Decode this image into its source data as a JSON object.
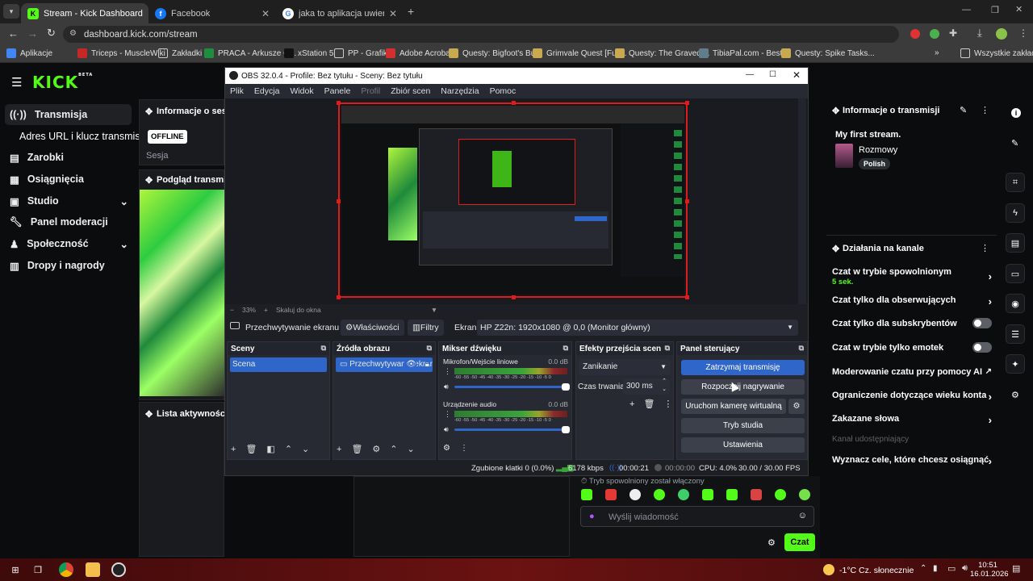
{
  "browser": {
    "tabs": [
      {
        "title": "Stream - Kick Dashboard",
        "active": true
      },
      {
        "title": "Facebook",
        "active": false
      },
      {
        "title": "jaka to aplikacja uwierzytelniająca",
        "active": false
      }
    ],
    "url": "dashboard.kick.com/stream",
    "bookmarks": [
      "Aplikacje",
      "Triceps - MuscleWiki",
      "Zakładki",
      "PRACA - Arkusze G...",
      "xStation 5",
      "PP - Grafik",
      "Adobe Acrobat",
      "Questy: Bigfoot's Bu...",
      "Grimvale Quest [Full...",
      "Questy: The Gravedi...",
      "TibiaPal.com - Besti...",
      "Questy: Spike Tasks..."
    ],
    "all_bookmarks": "Wszystkie zakładki"
  },
  "kick": {
    "logo": "KICK",
    "logo_badge": "BETA",
    "nav": [
      {
        "label": "Transmisja",
        "icon": "broadcast-icon"
      },
      {
        "label": "Adres URL i klucz transmisji",
        "icon": ""
      },
      {
        "label": "Zarobki",
        "icon": "wallet-icon"
      },
      {
        "label": "Osiągnięcia",
        "icon": "achievement-icon"
      },
      {
        "label": "Studio",
        "icon": "studio-icon"
      },
      {
        "label": "Panel moderacji",
        "icon": "wrench-icon"
      },
      {
        "label": "Społeczność",
        "icon": "community-icon"
      },
      {
        "label": "Dropy i nagrody",
        "icon": "gift-icon"
      }
    ],
    "session": {
      "title": "Informacje o sesji",
      "status": "OFFLINE",
      "label": "Sesja"
    },
    "preview_title": "Podgląd transmisji",
    "activity_title": "Lista aktywności",
    "stream_info": {
      "title": "Informacje o transmisji",
      "stream_name": "My first stream.",
      "category": "Rozmowy",
      "language": "Polish"
    },
    "channel_actions": {
      "title": "Działania na kanale",
      "items": [
        {
          "label": "Czat w trybie spowolnionym",
          "sub": "5 sek.",
          "control": "chevron"
        },
        {
          "label": "Czat tylko dla obserwujących",
          "sub": "",
          "control": "chevron"
        },
        {
          "label": "Czat tylko dla subskrybentów",
          "sub": "",
          "control": "toggle"
        },
        {
          "label": "Czat w trybie tylko emotek",
          "sub": "",
          "control": "toggle"
        },
        {
          "label": "Moderowanie czatu przy pomocy AI",
          "sub": "",
          "control": "external"
        },
        {
          "label": "Ograniczenie dotyczące wieku konta",
          "sub": "",
          "control": "chevron"
        },
        {
          "label": "Zakazane słowa",
          "sub": "",
          "control": "chevron"
        },
        {
          "label": "Kanał udostępniający",
          "sub": "",
          "control": "none"
        },
        {
          "label": "Wyznacz cele, które chcesz osiągnąć",
          "sub": "",
          "control": "chevron"
        }
      ]
    },
    "chat": {
      "notice": "Tryb spowolniony został włączony",
      "placeholder": "Wyślij wiadomość",
      "send": "Czat"
    }
  },
  "obs": {
    "title": "OBS 32.0.4 - Profile: Bez tytułu - Sceny: Bez tytułu",
    "menu": [
      "Plik",
      "Edycja",
      "Widok",
      "Panele",
      "Profil",
      "Zbiór scen",
      "Narzędzia",
      "Pomoc"
    ],
    "zoom": "33%",
    "scale_label": "Skaluj do okna",
    "source_bar": {
      "source": "Przechwytywanie ekranu",
      "properties": "Właściwości",
      "filters": "Filtry",
      "screen_label": "Ekran",
      "screen_value": "HP Z22n: 1920x1080 @ 0,0 (Monitor główny)"
    },
    "docks": {
      "scenes": {
        "title": "Sceny",
        "items": [
          "Scena"
        ]
      },
      "sources": {
        "title": "Źródła obrazu",
        "items": [
          "Przechwytywanie ekranu"
        ]
      },
      "mixer": {
        "title": "Mikser dźwięku",
        "channels": [
          {
            "name": "Mikrofon/Wejście liniowe",
            "db": "0.0 dB"
          },
          {
            "name": "Urządzenie audio",
            "db": "0.0 dB"
          }
        ],
        "scale": "-60 -55 -50 -45 -40 -35 -30 -25 -20 -15 -10 -5 0"
      },
      "transitions": {
        "title": "Efekty przejścia scen",
        "type": "Zanikanie",
        "duration_label": "Czas trwania",
        "duration": "300 ms"
      },
      "controls": {
        "title": "Panel sterujący",
        "buttons": [
          "Zatrzymaj transmisję",
          "Rozpocznij nagrywanie",
          "Uruchom kamerę wirtualną",
          "Tryb studia",
          "Ustawienia"
        ]
      }
    },
    "status": {
      "dropped": "Zgubione klatki 0 (0.0%)",
      "bitrate": "6178 kbps",
      "live_time": "00:00:21",
      "rec_time": "00:00:00",
      "cpu": "CPU: 4.0%",
      "fps": "30.00 / 30.00 FPS"
    }
  },
  "taskbar": {
    "weather": "-1°C Cz. słonecznie",
    "time": "10:51",
    "date": "16.01.2026"
  }
}
